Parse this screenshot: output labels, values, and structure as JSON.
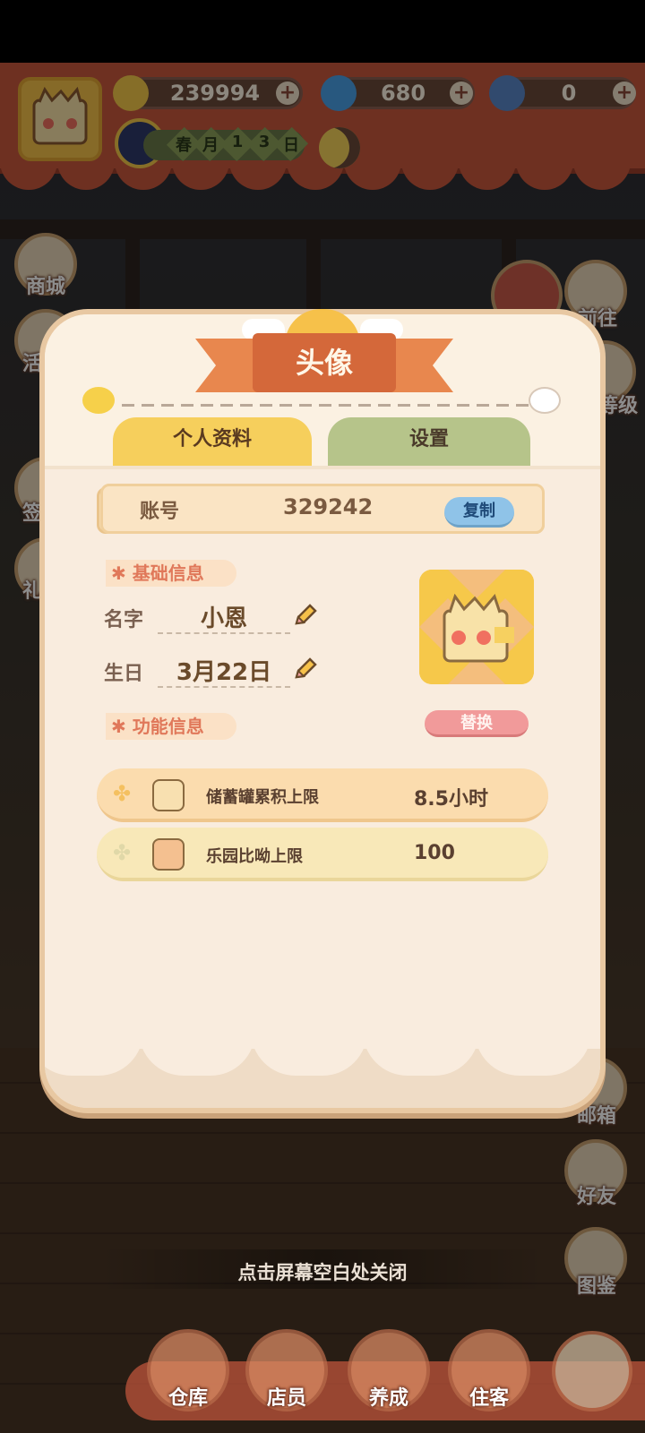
{
  "resources": {
    "bananas": "239994",
    "flames": "680",
    "blue_bananas": "0"
  },
  "calendar": {
    "chars": [
      "春",
      "月",
      "1",
      "3",
      "日"
    ]
  },
  "left_menu": [
    {
      "label": "商城"
    },
    {
      "label": "活"
    },
    {
      "label": "签"
    },
    {
      "label": "礼"
    }
  ],
  "right_menu": [
    {
      "label": "前往"
    },
    {
      "label": "等级"
    },
    {
      "label": "邮箱"
    },
    {
      "label": "好友"
    },
    {
      "label": "图鉴"
    }
  ],
  "dialog": {
    "title": "头像",
    "tabs": [
      {
        "label": "个人资料",
        "active": true
      },
      {
        "label": "设置",
        "active": false
      }
    ],
    "account": {
      "label": "账号",
      "value": "329242",
      "copy_label": "复制"
    },
    "basic_info": {
      "section_title": "基础信息",
      "name_label": "名字",
      "name_value": "小恩",
      "birthday_label": "生日",
      "birthday_value": "3月22日",
      "replace_label": "替换"
    },
    "function_info": {
      "section_title": "功能信息",
      "rows": [
        {
          "name": "储蓄罐累积上限",
          "value": "8.5小时"
        },
        {
          "name": "乐园比呦上限",
          "value": "100"
        }
      ]
    },
    "close_hint": "点击屏幕空白处关闭"
  },
  "bottom_nav": [
    {
      "label": "仓库"
    },
    {
      "label": "店员"
    },
    {
      "label": "养成"
    },
    {
      "label": "住客"
    }
  ]
}
